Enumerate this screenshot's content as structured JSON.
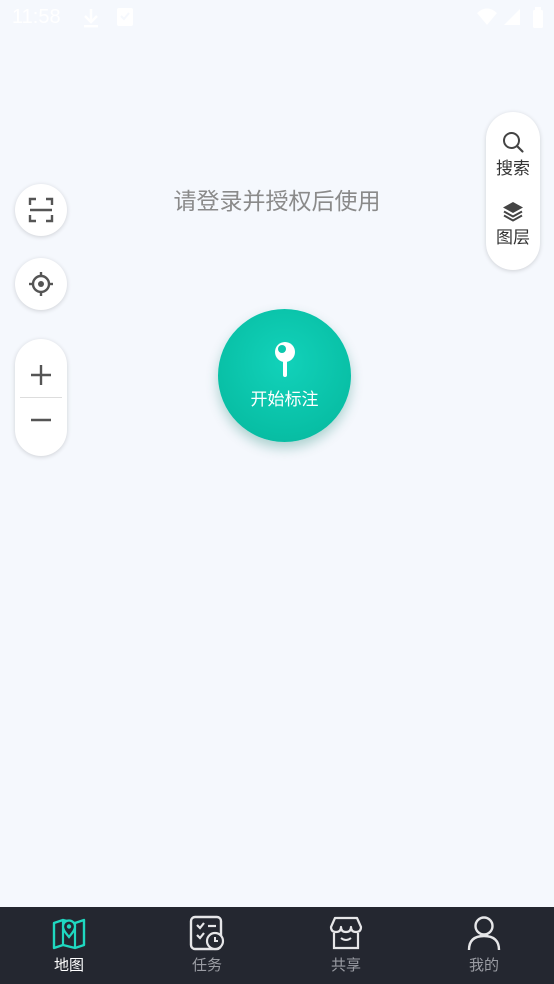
{
  "status_bar": {
    "time": "11:58"
  },
  "map": {
    "login_prompt": "请登录并授权后使用"
  },
  "right_panel": {
    "search_label": "搜索",
    "layers_label": "图层"
  },
  "left_controls": {
    "fullscreen_icon": "scan-frame-icon",
    "locate_icon": "crosshair-icon",
    "zoom_in_icon": "plus-icon",
    "zoom_out_icon": "minus-icon"
  },
  "start_button": {
    "label": "开始标注",
    "icon": "pin-icon",
    "color": "#0cc7ad"
  },
  "bottom_nav": {
    "active_color": "#1fd8c0",
    "items": [
      {
        "label": "地图",
        "icon": "map-icon",
        "active": true
      },
      {
        "label": "任务",
        "icon": "task-icon",
        "active": false
      },
      {
        "label": "共享",
        "icon": "store-icon",
        "active": false
      },
      {
        "label": "我的",
        "icon": "user-icon",
        "active": false
      }
    ]
  }
}
